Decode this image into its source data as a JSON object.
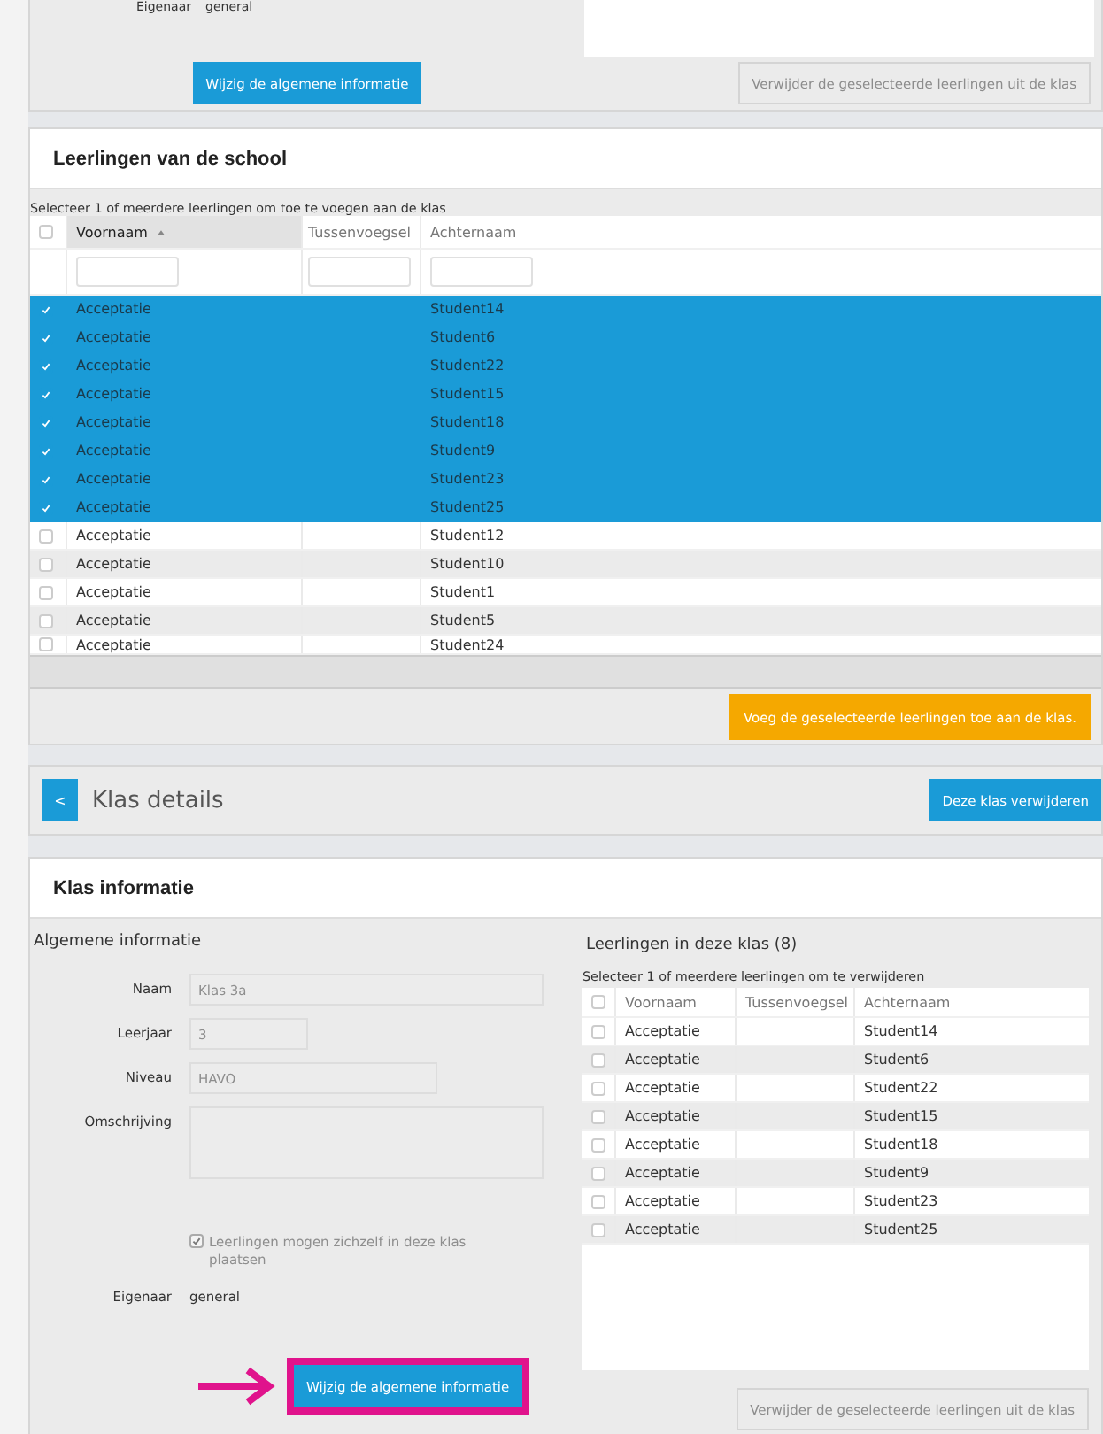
{
  "top_panel": {
    "owner_label": "Eigenaar",
    "owner_value": "general",
    "edit_button": {
      "label": "Wijzig de algemene informatie",
      "highlighted": false
    },
    "remove_button": {
      "label": "Verwijder de geselecteerde leerlingen uit de klas",
      "disabled": true
    }
  },
  "school_students": {
    "title": "Leerlingen van de school",
    "hint": "Selecteer 1 of meerdere leerlingen om toe te voegen aan de klas",
    "select_all_checked": false,
    "columns": [
      {
        "label": "Voornaam",
        "sorted": true
      },
      {
        "label": "Tussenvoegsel",
        "sorted": false
      },
      {
        "label": "Achternaam",
        "sorted": false
      }
    ],
    "rows": [
      {
        "first_name": "Acceptatie",
        "last_name": "Student14",
        "selected": true
      },
      {
        "first_name": "Acceptatie",
        "last_name": "Student6",
        "selected": true
      },
      {
        "first_name": "Acceptatie",
        "last_name": "Student22",
        "selected": true
      },
      {
        "first_name": "Acceptatie",
        "last_name": "Student15",
        "selected": true
      },
      {
        "first_name": "Acceptatie",
        "last_name": "Student18",
        "selected": true
      },
      {
        "first_name": "Acceptatie",
        "last_name": "Student9",
        "selected": true
      },
      {
        "first_name": "Acceptatie",
        "last_name": "Student23",
        "selected": true
      },
      {
        "first_name": "Acceptatie",
        "last_name": "Student25",
        "selected": true
      },
      {
        "first_name": "Acceptatie",
        "last_name": "Student12",
        "selected": false
      },
      {
        "first_name": "Acceptatie",
        "last_name": "Student10",
        "selected": false
      },
      {
        "first_name": "Acceptatie",
        "last_name": "Student1",
        "selected": false
      },
      {
        "first_name": "Acceptatie",
        "last_name": "Student5",
        "selected": false
      },
      {
        "first_name": "Acceptatie",
        "last_name": "Student24",
        "selected": false
      }
    ],
    "add_button": "Voeg de geselecteerde leerlingen toe aan de klas."
  },
  "class_details": {
    "back_button": "<",
    "title": "Klas details",
    "delete_button": "Deze klas verwijderen"
  },
  "class_info": {
    "title": "Klas informatie",
    "general": {
      "heading": "Algemene informatie",
      "fields": [
        {
          "kind": "text",
          "label": "Naam",
          "value": "Klas 3a",
          "disabled": true
        },
        {
          "kind": "text",
          "label": "Leerjaar",
          "value": "3",
          "disabled": true
        },
        {
          "kind": "text",
          "label": "Niveau",
          "value": "HAVO",
          "disabled": true
        },
        {
          "kind": "textarea",
          "label": "Omschrijving",
          "disabled": true
        }
      ],
      "self_enroll": {
        "label": "Leerlingen mogen zichzelf in deze klas plaatsen",
        "checked": true,
        "disabled": true
      },
      "owner_label": "Eigenaar",
      "owner_value": "general",
      "edit_button": {
        "label": "Wijzig de algemene informatie",
        "highlighted": true
      }
    },
    "members": {
      "heading": "Leerlingen in deze klas (8)",
      "hint": "Selecteer 1 of meerdere leerlingen om te verwijderen",
      "select_all_checked": false,
      "columns": [
        {
          "label": "Voornaam",
          "sorted": false
        },
        {
          "label": "Tussenvoegsel",
          "sorted": false
        },
        {
          "label": "Achternaam",
          "sorted": false
        }
      ],
      "rows": [
        {
          "first_name": "Acceptatie",
          "last_name": "Student14",
          "selected": false
        },
        {
          "first_name": "Acceptatie",
          "last_name": "Student6",
          "selected": false
        },
        {
          "first_name": "Acceptatie",
          "last_name": "Student22",
          "selected": false
        },
        {
          "first_name": "Acceptatie",
          "last_name": "Student15",
          "selected": false
        },
        {
          "first_name": "Acceptatie",
          "last_name": "Student18",
          "selected": false
        },
        {
          "first_name": "Acceptatie",
          "last_name": "Student9",
          "selected": false
        },
        {
          "first_name": "Acceptatie",
          "last_name": "Student23",
          "selected": false
        },
        {
          "first_name": "Acceptatie",
          "last_name": "Student25",
          "selected": false
        }
      ],
      "remove_button": {
        "label": "Verwijder de geselecteerde leerlingen uit de klas",
        "disabled": true
      }
    }
  }
}
